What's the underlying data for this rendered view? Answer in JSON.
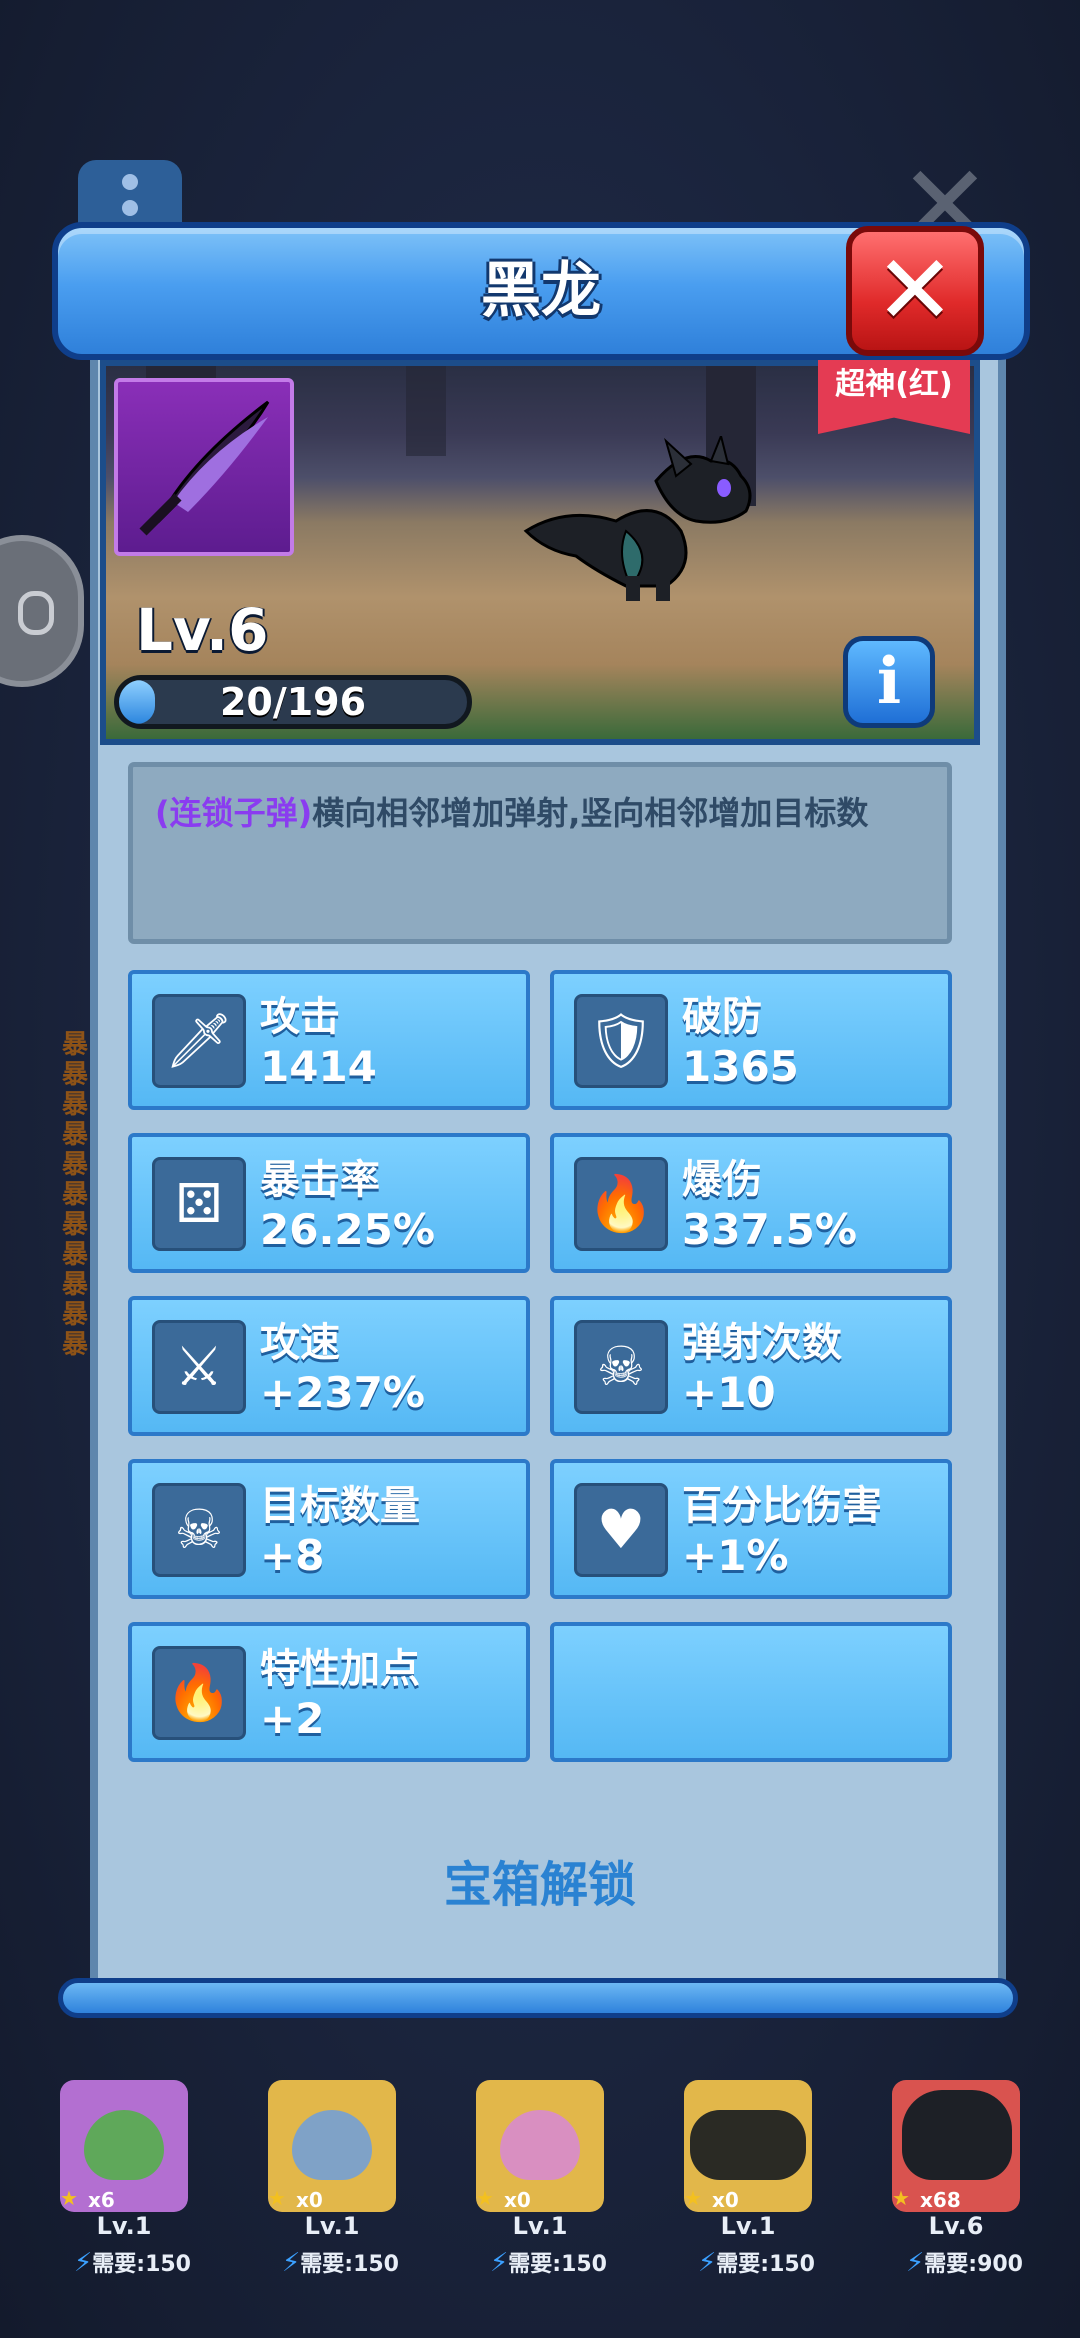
{
  "dialog": {
    "title": "黑龙",
    "close_icon": "close-icon",
    "rank_badge": "超神(红)",
    "level": "Lv.6",
    "xp": {
      "current": 20,
      "max": 196,
      "text": "20/196"
    },
    "info_label": "i",
    "description": {
      "highlight": "(连锁子弹)",
      "text": "横向相邻增加弹射,竖向相邻增加目标数"
    },
    "stats": [
      {
        "label": "攻击",
        "value": "1414",
        "icon": "sword-icon"
      },
      {
        "label": "破防",
        "value": "1365",
        "icon": "broken-shield-icon"
      },
      {
        "label": "暴击率",
        "value": "26.25%",
        "icon": "dice-icon"
      },
      {
        "label": "爆伤",
        "value": "337.5%",
        "icon": "flaming-sword-icon"
      },
      {
        "label": "攻速",
        "value": "+237%",
        "icon": "swift-sword-icon"
      },
      {
        "label": "弹射次数",
        "value": "+10",
        "icon": "skull-target-icon"
      },
      {
        "label": "目标数量",
        "value": "+8",
        "icon": "skull-target-icon"
      },
      {
        "label": "百分比伤害",
        "value": "+1%",
        "icon": "sword-heart-icon"
      },
      {
        "label": "特性加点",
        "value": "+2",
        "icon": "fire-slash-icon"
      }
    ],
    "unlock_text": "宝箱解锁"
  },
  "roster": [
    {
      "count": "x6",
      "level": "Lv.1",
      "cost": "需要:150",
      "color": "#b36fd1"
    },
    {
      "count": "x0",
      "level": "Lv.1",
      "cost": "需要:150",
      "color": "#e2b74a"
    },
    {
      "count": "x0",
      "level": "Lv.1",
      "cost": "需要:150",
      "color": "#e2b74a"
    },
    {
      "count": "x0",
      "level": "Lv.1",
      "cost": "需要:150",
      "color": "#e2b74a"
    },
    {
      "count": "x68",
      "level": "Lv.6",
      "cost": "需要:900",
      "color": "#d9534f"
    }
  ],
  "background_text": "暴暴暴暴暴暴暴暴暴暴暴"
}
